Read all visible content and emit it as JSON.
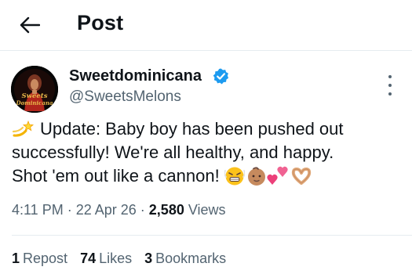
{
  "header": {
    "title": "Post",
    "back_icon": "arrow-left-icon"
  },
  "author": {
    "name": "Sweetdominicana",
    "handle": "@SweetsMelons",
    "verified": true,
    "verified_color": "#1d9bf0",
    "avatar_text": "Sweets Dominicana"
  },
  "post": {
    "lines": [
      "Update: Baby boy has been pushed out",
      "successfully! We're all healthy, and happy.",
      "Shot 'em out like a cannon!"
    ],
    "leading_emoji": "dizzy-icon",
    "trailing_emojis": [
      "grimacing-face-icon",
      "baby-icon",
      "two-hearts-icon",
      "heart-hands-icon"
    ]
  },
  "meta": {
    "time": "4:11 PM",
    "date": "22 Apr 26",
    "views_count": "2,580",
    "views_label": "Views"
  },
  "stats": {
    "reposts_count": "1",
    "reposts_label": "Repost",
    "likes_count": "74",
    "likes_label": "Likes",
    "bookmarks_count": "3",
    "bookmarks_label": "Bookmarks"
  },
  "colors": {
    "text_primary": "#0f1419",
    "text_secondary": "#536471",
    "accent": "#1d9bf0",
    "divider": "#e6ecf0"
  }
}
